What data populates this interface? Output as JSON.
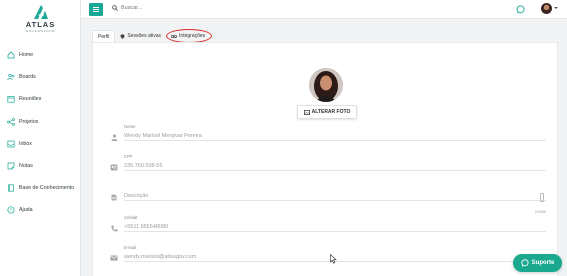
{
  "brand": {
    "name": "ATLAS",
    "tagline": "GOVERNANCE"
  },
  "colors": {
    "accent": "#19a896",
    "highlight": "#d6312f",
    "support": "#1aa98f"
  },
  "sidebar": {
    "items": [
      {
        "label": "Home",
        "icon": "home-icon"
      },
      {
        "label": "Boards",
        "icon": "users-icon"
      },
      {
        "label": "Reuniões",
        "icon": "calendar-icon"
      },
      {
        "label": "Projetos",
        "icon": "share-icon"
      },
      {
        "label": "Inbox",
        "icon": "inbox-icon"
      },
      {
        "label": "Notas",
        "icon": "note-icon"
      },
      {
        "label": "Base de Conhecimento",
        "icon": "book-icon"
      },
      {
        "label": "Ajuda",
        "icon": "help-icon"
      }
    ]
  },
  "topbar": {
    "search_placeholder": "Buscar..."
  },
  "tabs": [
    {
      "label": "Perfil",
      "active": true
    },
    {
      "label": "Sessões ativas",
      "icon": "shield-icon"
    },
    {
      "label": "Integrações",
      "icon": "link-icon"
    }
  ],
  "profile": {
    "change_photo_label": "ALTERAR FOTO",
    "fields": [
      {
        "label": "Nome",
        "value": "Wendy Marisol Menjivar Pereira",
        "icon": "person-icon"
      },
      {
        "label": "CPF",
        "value": "235.760.508-55",
        "icon": "id-card-icon"
      },
      {
        "label": "",
        "placeholder": "Descrição",
        "value": "",
        "icon": "document-icon",
        "counter": "0/1000"
      },
      {
        "label": "Celular",
        "value": "+5511 955548080",
        "icon": "phone-icon"
      },
      {
        "label": "E-mail",
        "value": "wendy.marisol@atlasgov.com",
        "icon": "email-icon"
      }
    ]
  },
  "support": {
    "label": "Suporte"
  }
}
